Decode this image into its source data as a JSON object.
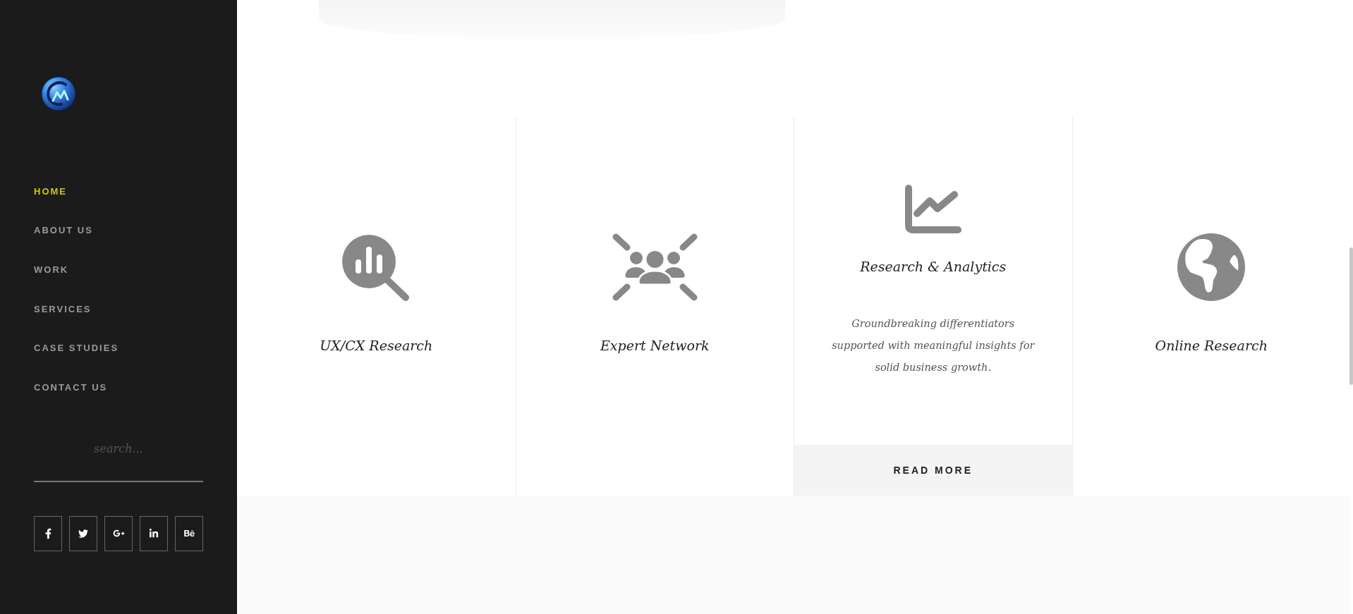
{
  "sidebar": {
    "nav": [
      {
        "label": "HOME",
        "selected": true
      },
      {
        "label": "ABOUT US",
        "selected": false
      },
      {
        "label": "WORK",
        "selected": false
      },
      {
        "label": "SERVICES",
        "selected": false
      },
      {
        "label": "CASE STUDIES",
        "selected": false
      },
      {
        "label": "CONTACT US",
        "selected": false
      }
    ],
    "search": {
      "placeholder": "search..."
    }
  },
  "services": [
    {
      "title": "UX/CX Research"
    },
    {
      "title": "Expert Network"
    },
    {
      "title": "Research & Analytics",
      "description": "Groundbreaking differentiators supported with meaningful insights for solid business growth.",
      "button": "READ MORE"
    },
    {
      "title": "Online Research"
    }
  ]
}
